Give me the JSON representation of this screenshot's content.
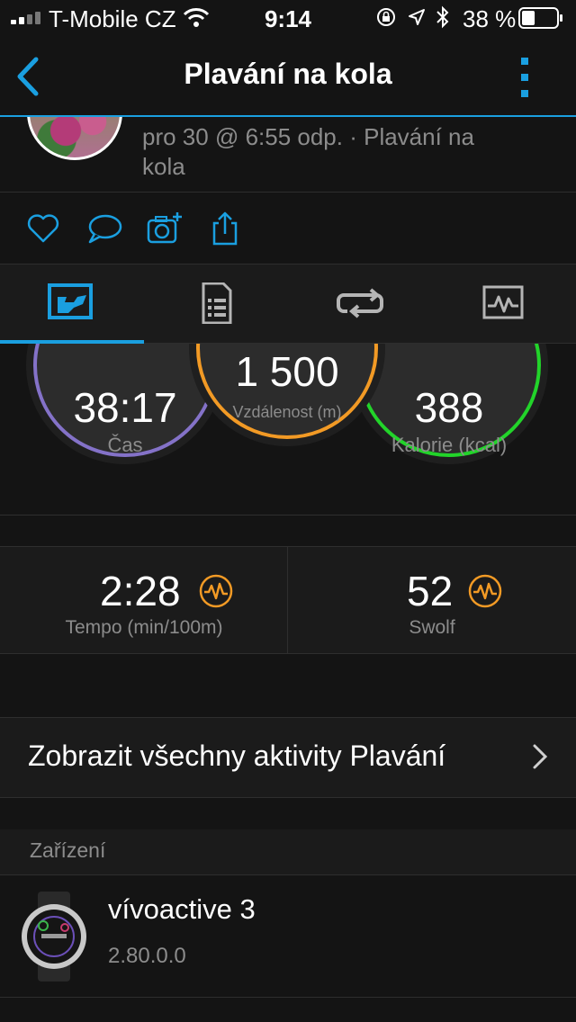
{
  "status_bar": {
    "carrier": "T-Mobile CZ",
    "time": "9:14",
    "battery": "38 %",
    "battery_level": 0.38
  },
  "nav": {
    "title": "Plavání na kola",
    "back_icon": "chevron-left-icon",
    "more_icon": "vertical-dots-icon"
  },
  "header": {
    "subtitle": "pro 30 @ 6:55 odp. · Plavání na kola"
  },
  "actions": [
    "heart-icon",
    "comment-icon",
    "add-photo-icon",
    "share-icon"
  ],
  "tabs": [
    {
      "icon": "overview-icon",
      "active": true
    },
    {
      "icon": "details-icon",
      "active": false
    },
    {
      "icon": "laps-icon",
      "active": false
    },
    {
      "icon": "charts-icon",
      "active": false
    }
  ],
  "stats": {
    "time": {
      "value": "38:17",
      "label": "Čas"
    },
    "distance": {
      "value": "1 500",
      "label": "Vzdálenost (m)"
    },
    "calories": {
      "value": "388",
      "label": "Kalorie (kcal)"
    }
  },
  "metrics": [
    {
      "value": "2:28",
      "label": "Tempo (min/100m)",
      "icon": "activity-wave-icon"
    },
    {
      "value": "52",
      "label": "Swolf",
      "icon": "activity-wave-icon"
    }
  ],
  "link": {
    "label": "Zobrazit všechny aktivity Plavání"
  },
  "devices": {
    "heading": "Zařízení",
    "name": "vívoactive 3",
    "version": "2.80.0.0"
  },
  "colors": {
    "accent": "#1a9fe0",
    "time_ring": "#8472c8",
    "distance_ring": "#f29a25",
    "calories_ring": "#22d42a",
    "background": "#141414"
  }
}
